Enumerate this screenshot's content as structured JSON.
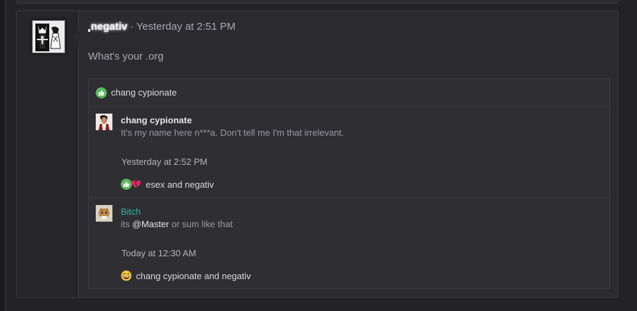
{
  "post": {
    "username": "negativ",
    "separator": "·",
    "timestamp": "Yesterday at 2:51 PM",
    "body": "What's your .org"
  },
  "reactions_summary": {
    "icon": "like-icon",
    "users": "chang cypionate"
  },
  "replies": [
    {
      "author": "chang cypionate",
      "text": "It's my name here n***a. Don't tell me I'm that irrelevant.",
      "timestamp": "Yesterday at 2:52 PM",
      "reaction_icons": [
        "like-icon",
        "love-icon"
      ],
      "reaction_users": "esex and negativ"
    },
    {
      "author": "Bitch",
      "author_color": "#2bb5a3",
      "text_prefix": "its",
      "mention": "@Master",
      "text_suffix": "or sum like that",
      "timestamp": "Today at 12:30 AM",
      "reaction_icons": [
        "laugh-icon"
      ],
      "reaction_users": "chang cypionate and negativ"
    }
  ],
  "colors": {
    "background": "#232327",
    "panel": "#2a2a2f",
    "like": "#5cb85c",
    "love": "#e0245e",
    "laugh": "#f5c33b",
    "accent_teal": "#2bb5a3"
  }
}
